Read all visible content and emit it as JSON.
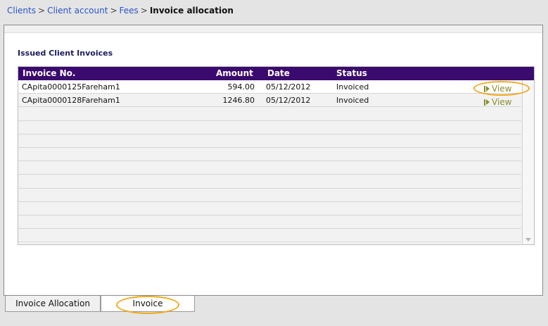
{
  "breadcrumb": {
    "items": [
      "Clients",
      "Client account",
      "Fees"
    ],
    "separator": ">",
    "current": "Invoice allocation"
  },
  "section": {
    "title": "Issued Client Invoices"
  },
  "table": {
    "headers": {
      "invoice": "Invoice No.",
      "amount": "Amount",
      "date": "Date",
      "status": "Status"
    },
    "rows": [
      {
        "invoice": "CApita0000125Fareham1",
        "amount": "594.00",
        "date": "05/12/2012",
        "status": "Invoiced",
        "action": "View"
      },
      {
        "invoice": "CApita0000128Fareham1",
        "amount": "1246.80",
        "date": "05/12/2012",
        "status": "Invoiced",
        "action": "View"
      }
    ]
  },
  "tabs": [
    {
      "label": "Invoice Allocation",
      "active": false
    },
    {
      "label": "Invoice",
      "active": true
    }
  ],
  "colors": {
    "header_bg": "#3b0a6e",
    "link": "#2a55c8",
    "view_link": "#8c8c2c",
    "highlight": "#f0a818"
  }
}
